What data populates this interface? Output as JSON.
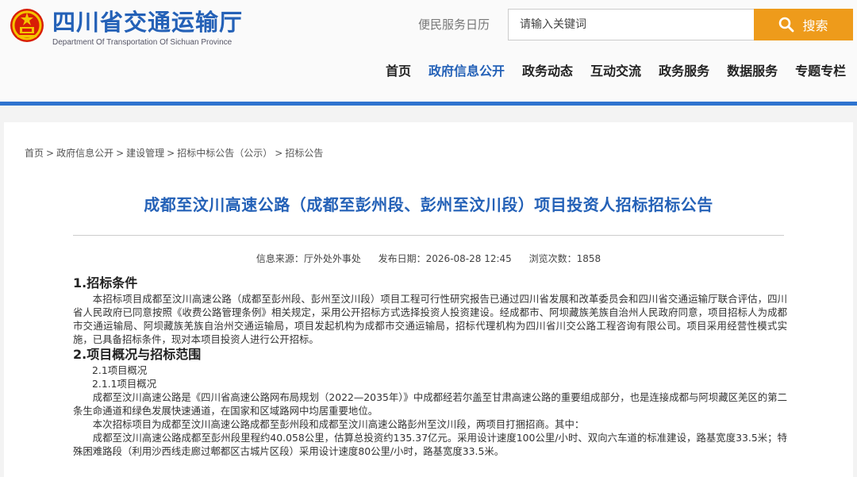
{
  "header": {
    "site_title": "四川省交通运输厅",
    "site_subtitle": "Department Of Transportation Of Sichuan Province",
    "convenience_link": "便民服务日历",
    "search_placeholder": "请输入关键词",
    "search_button": "搜索",
    "colors": {
      "brand_blue": "#2461b7",
      "search_orange": "#ee9b1b",
      "rule_blue": "#2e73cf"
    }
  },
  "nav": [
    {
      "label": "首页"
    },
    {
      "label": "政府信息公开",
      "active": true
    },
    {
      "label": "政务动态"
    },
    {
      "label": "互动交流"
    },
    {
      "label": "政务服务"
    },
    {
      "label": "数据服务"
    },
    {
      "label": "专题专栏"
    }
  ],
  "breadcrumb": [
    "首页",
    "政府信息公开",
    "建设管理",
    "招标中标公告（公示）",
    "招标公告"
  ],
  "article": {
    "title": "成都至汶川高速公路（成都至彭州段、彭州至汶川段）项目投资人招标招标公告",
    "source": "信息来源：厅外处外事处",
    "date": "发布日期：2026-08-28 12:45",
    "views": "浏览次数：1858",
    "sec1_heading": "1.招标条件",
    "sec1_para": "本招标项目成都至汶川高速公路（成都至彭州段、彭州至汶川段）项目工程可行性研究报告已通过四川省发展和改革委员会和四川省交通运输厅联合评估，四川省人民政府已同意按照《收费公路管理条例》相关规定，采用公开招标方式选择投资人投资建设。经成都市、阿坝藏族羌族自治州人民政府同意，项目招标人为成都市交通运输局、阿坝藏族羌族自治州交通运输局，项目发起机构为成都市交通运输局，招标代理机构为四川省川交公路工程咨询有限公司。项目采用经营性模式实施，已具备招标条件，现对本项目投资人进行公开招标。",
    "sec2_heading": "2.项目概况与招标范围",
    "sub_2_1": "2.1项目概况",
    "sub_2_1_1": "2.1.1项目概况",
    "para_2": "成都至汶川高速公路是《四川省高速公路网布局规划（2022—2035年）》中成都经若尔盖至甘肃高速公路的重要组成部分，也是连接成都与阿坝藏区羌区的第二条生命通道和绿色发展快速通道，在国家和区域路网中均居重要地位。",
    "para_3": "本次招标项目为成都至汶川高速公路成都至彭州段和成都至汶川高速公路彭州至汶川段，两项目打捆招商。其中：",
    "para_4": "成都至汶川高速公路成都至彭州段里程约40.058公里，估算总投资约135.37亿元。采用设计速度100公里/小时、双向六车道的标准建设，路基宽度33.5米；特殊困难路段（利用沙西线走廊过郫都区古城片区段）采用设计速度80公里/小时，路基宽度33.5米。"
  }
}
